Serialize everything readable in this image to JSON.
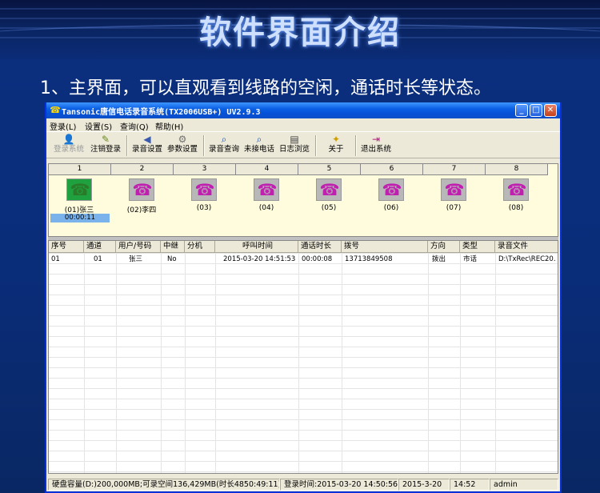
{
  "slide": {
    "title": "软件界面介绍",
    "subtitle": "1、主界面，可以直观看到线路的空闲，通话时长等状态。"
  },
  "window": {
    "title": "Tansonic唐信电话录音系统(TX2006USB+) UV2.9.3",
    "controls": {
      "minimize": "_",
      "maximize": "□",
      "close": "✕"
    }
  },
  "menu": [
    "登录(L)",
    "设置(S)",
    "查询(Q)",
    "帮助(H)"
  ],
  "toolbar": [
    {
      "label": "登录系统",
      "icon": "user-icon",
      "enabled": false
    },
    {
      "label": "注销登录",
      "icon": "logout-icon",
      "enabled": true
    },
    {
      "label": "录音设置",
      "icon": "speaker-icon",
      "enabled": true
    },
    {
      "label": "参数设置",
      "icon": "gear-icon",
      "enabled": true
    },
    {
      "label": "录音查询",
      "icon": "search-icon",
      "enabled": true
    },
    {
      "label": "未接电话",
      "icon": "search-icon",
      "enabled": true
    },
    {
      "label": "日志浏览",
      "icon": "document-icon",
      "enabled": true
    },
    {
      "label": "关于",
      "icon": "lightbulb-icon",
      "enabled": true
    },
    {
      "label": "退出系统",
      "icon": "exit-icon",
      "enabled": true
    }
  ],
  "lines": [
    {
      "num": "1",
      "label": "(01)张三",
      "duration": "00:00:11",
      "active": true
    },
    {
      "num": "2",
      "label": "(02)李四",
      "duration": "",
      "active": false
    },
    {
      "num": "3",
      "label": "(03)",
      "duration": "",
      "active": false
    },
    {
      "num": "4",
      "label": "(04)",
      "duration": "",
      "active": false
    },
    {
      "num": "5",
      "label": "(05)",
      "duration": "",
      "active": false
    },
    {
      "num": "6",
      "label": "(06)",
      "duration": "",
      "active": false
    },
    {
      "num": "7",
      "label": "(07)",
      "duration": "",
      "active": false
    },
    {
      "num": "8",
      "label": "(08)",
      "duration": "",
      "active": false
    }
  ],
  "table": {
    "columns": [
      "序号",
      "通道",
      "用户/号码",
      "中继",
      "分机",
      "呼叫时间",
      "通话时长",
      "拨号",
      "方向",
      "类型",
      "录音文件"
    ],
    "rows": [
      [
        "01",
        "01",
        "张三",
        "No",
        "",
        "2015-03-20 14:51:53",
        "00:00:08",
        "13713849508",
        "拨出",
        "市话",
        "D:\\TxRec\\REC20..."
      ]
    ]
  },
  "status": {
    "disk": "硬盘容量(D:)200,000MB;可录空间136,429MB(时长4850:49:11)",
    "login_time": "登录时间:2015-03-20 14:50:56",
    "date": "2015-3-20",
    "time": "14:52",
    "user": "admin"
  },
  "colors": {
    "active_line": "#1fa13f",
    "idle_line": "#b8b8b8",
    "phone": "#c01fb0",
    "duration_bg": "#7ab3ec"
  }
}
